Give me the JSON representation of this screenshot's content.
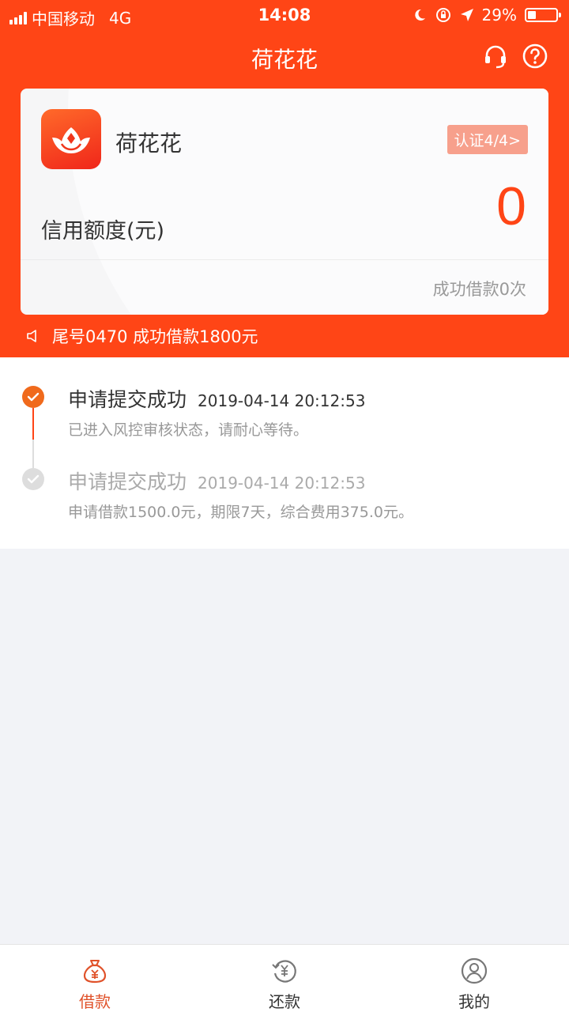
{
  "status_bar": {
    "carrier": "中国移动",
    "network": "4G",
    "time": "14:08",
    "battery": "29%",
    "battery_level": 0.29
  },
  "header": {
    "title": "荷花花",
    "icons": [
      "headset-icon",
      "help-icon"
    ]
  },
  "card": {
    "app_name": "荷花花",
    "cert_badge": "认证4/4>",
    "credit_label": "信用额度(元)",
    "credit_value": "0",
    "loan_count": "成功借款0次"
  },
  "notice": {
    "text": "尾号0470 成功借款1800元"
  },
  "timeline": [
    {
      "title": "申请提交成功",
      "time": "2019-04-14 20:12:53",
      "desc": "已进入风控审核状态，请耐心等待。",
      "active": true
    },
    {
      "title": "申请提交成功",
      "time": "2019-04-14 20:12:53",
      "desc": "申请借款1500.0元，期限7天，综合费用375.0元。",
      "active": false
    }
  ],
  "tabs": [
    {
      "label": "借款",
      "icon": "money-bag-icon",
      "active": true
    },
    {
      "label": "还款",
      "icon": "repay-icon",
      "active": false
    },
    {
      "label": "我的",
      "icon": "user-icon",
      "active": false
    }
  ],
  "colors": {
    "brand": "#ff4516",
    "active_tab": "#e0522a",
    "badge": "#f7a08c"
  }
}
